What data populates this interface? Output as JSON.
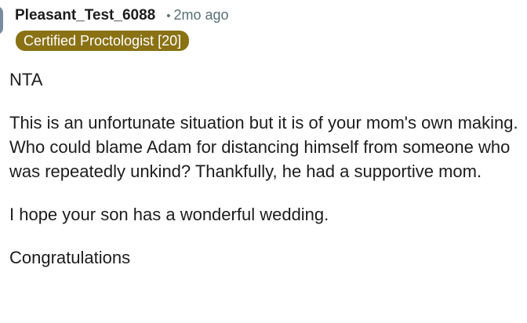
{
  "comment": {
    "username": "Pleasant_Test_6088",
    "separator": "•",
    "time": "2mo ago",
    "flair": "Certified Proctologist [20]",
    "paragraphs": [
      "NTA",
      "This is an unfortunate situation but it is of your mom's own making. Who could blame Adam for distancing himself from someone who was repeatedly unkind? Thankfully, he had a supportive mom.",
      "I hope your son has a wonderful wedding.",
      "Congratulations"
    ]
  },
  "colors": {
    "flair_background": "#8a7214",
    "flair_text": "#ffffff",
    "meta_text": "#576f76",
    "body_text": "#1c1c1c"
  }
}
